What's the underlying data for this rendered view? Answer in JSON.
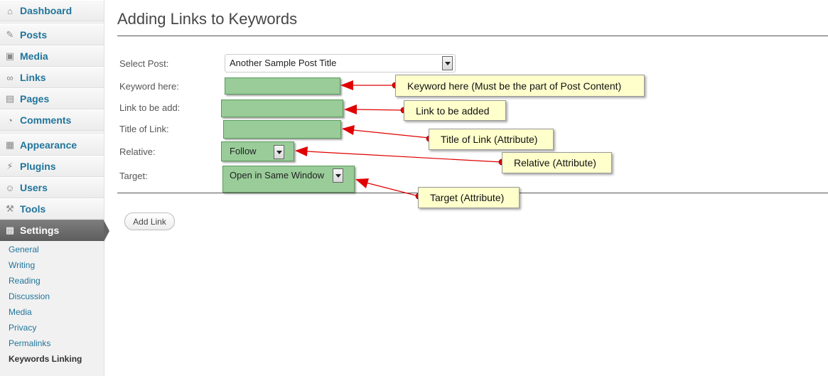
{
  "sidebar": {
    "items": [
      {
        "label": "Dashboard",
        "icon": "dashboard-icon"
      },
      {
        "label": "Posts",
        "icon": "pin-icon"
      },
      {
        "label": "Media",
        "icon": "media-icon"
      },
      {
        "label": "Links",
        "icon": "link-icon"
      },
      {
        "label": "Pages",
        "icon": "pages-icon"
      },
      {
        "label": "Comments",
        "icon": "comment-icon"
      },
      {
        "label": "Appearance",
        "icon": "appearance-icon"
      },
      {
        "label": "Plugins",
        "icon": "plugin-icon"
      },
      {
        "label": "Users",
        "icon": "users-icon"
      },
      {
        "label": "Tools",
        "icon": "tools-icon"
      },
      {
        "label": "Settings",
        "icon": "settings-icon"
      }
    ],
    "submenu": [
      "General",
      "Writing",
      "Reading",
      "Discussion",
      "Media",
      "Privacy",
      "Permalinks",
      "Keywords Linking"
    ]
  },
  "page": {
    "title": "Adding Links to Keywords"
  },
  "form": {
    "select_post_label": "Select Post:",
    "select_post_value": "Another Sample Post Title",
    "keyword_label": "Keyword here:",
    "link_label": "Link to be add:",
    "title_label": "Title of Link:",
    "relative_label": "Relative:",
    "relative_value": "Follow",
    "target_label": "Target:",
    "target_value": "Open in Same Window",
    "add_button": "Add Link"
  },
  "callouts": {
    "keyword": "Keyword here (Must be the part of Post Content)",
    "link": "Link to be added",
    "title": "Title of Link (Attribute)",
    "relative": "Relative (Attribute)",
    "target": "Target (Attribute)"
  },
  "colors": {
    "link": "#21759b",
    "field_green": "#99cc99",
    "callout_yellow": "#ffffcc",
    "arrow_red": "#e00000"
  }
}
